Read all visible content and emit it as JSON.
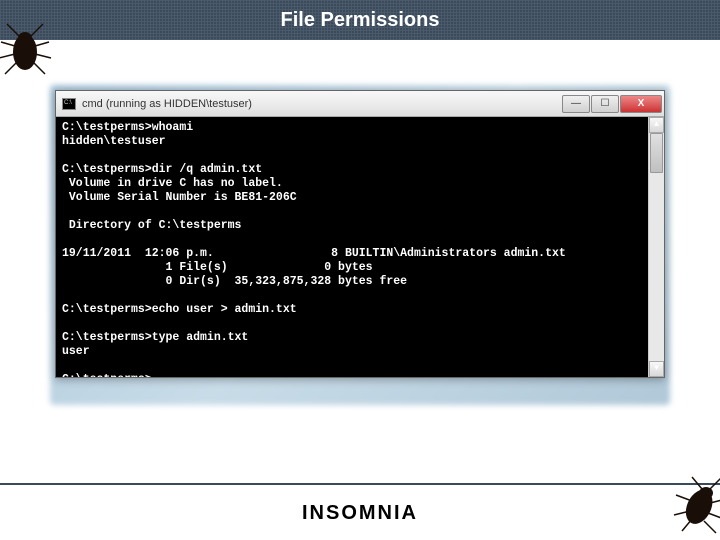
{
  "header": {
    "title": "File Permissions"
  },
  "window": {
    "title": "cmd (running as HIDDEN\\testuser)",
    "buttons": {
      "min": "—",
      "max": "☐",
      "close": "X"
    }
  },
  "terminal": {
    "lines": [
      "C:\\testperms>whoami",
      "hidden\\testuser",
      "",
      "C:\\testperms>dir /q admin.txt",
      " Volume in drive C has no label.",
      " Volume Serial Number is BE81-206C",
      "",
      " Directory of C:\\testperms",
      "",
      "19/11/2011  12:06 p.m.                 8 BUILTIN\\Administrators admin.txt",
      "               1 File(s)              0 bytes",
      "               0 Dir(s)  35,323,875,328 bytes free",
      "",
      "C:\\testperms>echo user > admin.txt",
      "",
      "C:\\testperms>type admin.txt",
      "user",
      "",
      "C:\\testperms>"
    ]
  },
  "scrollbar": {
    "up": "▲",
    "down": "▼"
  },
  "footer": {
    "brand": "INSOMNIA"
  }
}
